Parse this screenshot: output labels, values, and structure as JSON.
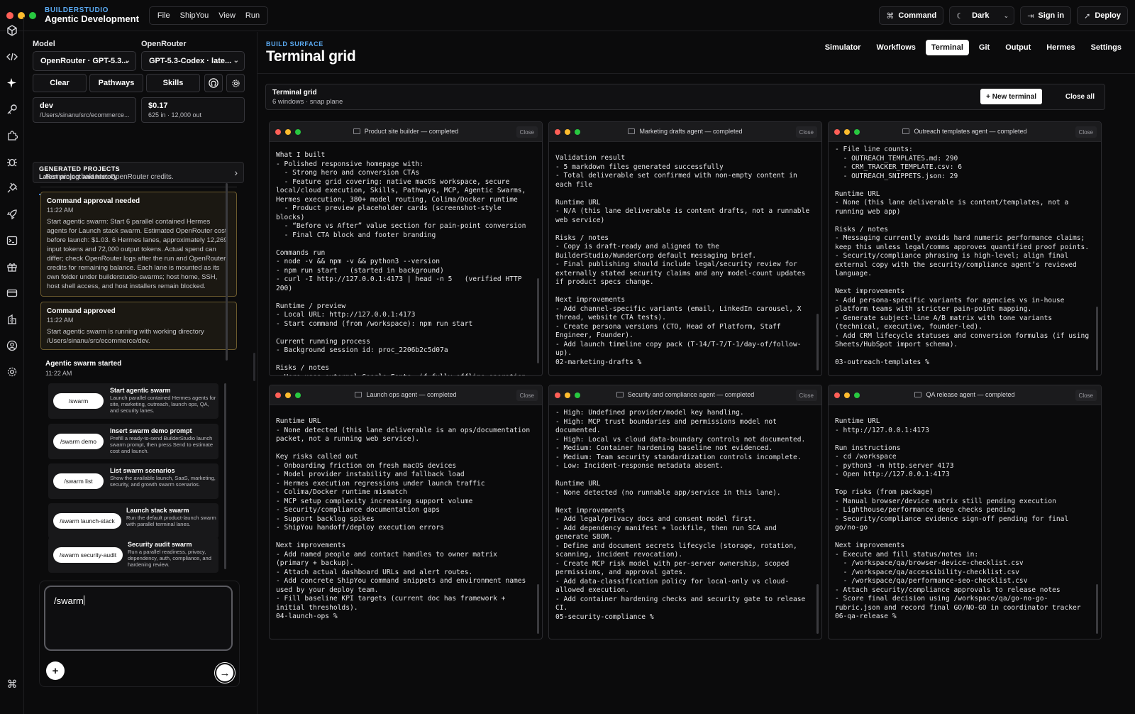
{
  "topbar": {
    "brand_eyebrow": "BUILDERSTUDIO",
    "brand_name": "Agentic Development",
    "menu": [
      "File",
      "ShipYou",
      "View",
      "Run"
    ],
    "command_label": "Command",
    "theme_label": "Dark",
    "signin_label": "Sign in",
    "deploy_label": "Deploy"
  },
  "left": {
    "model_label": "Model",
    "router_label": "OpenRouter",
    "model_value": "OpenRouter · GPT-5.3...",
    "router_value": "GPT-5.3-Codex · late...",
    "btn_clear": "Clear",
    "btn_pathways": "Pathways",
    "btn_skills": "Skills",
    "branch": "dev",
    "branch_path": "/Users/sinanu/src/ecommerce...",
    "cost": "$0.17",
    "tokens": "625 in · 12,000 out",
    "generated_title": "GENERATED PROJECTS",
    "generated_sub": "Latest project and history",
    "balance_text": "Remaining balance: OpenRouter credits.",
    "card1": {
      "title": "Command approval needed",
      "time": "11:22 AM",
      "body": "Start agentic swarm: Start 6 parallel contained Hermes agents for Launch stack swarm. Estimated OpenRouter cost before launch: $1.03. 6 Hermes lanes, approximately 12,269 input tokens and 72,000 output tokens. Actual spend can differ; check OpenRouter logs after the run and OpenRouter credits for remaining balance. Each lane is mounted as its own folder under builderstudio-swarms; host home, SSH, host shell access, and host installers remain blocked."
    },
    "card2": {
      "title": "Command approved",
      "time": "11:22 AM",
      "body": "Start agentic swarm is running with working directory /Users/sinanu/src/ecommerce/dev."
    },
    "swarm_started": "Agentic swarm started",
    "swarm_time": "11:22 AM",
    "commands": [
      {
        "pill": "/swarm",
        "title": "Start agentic swarm",
        "desc": "Launch parallel contained Hermes agents for site, marketing, outreach, launch ops, QA, and security lanes."
      },
      {
        "pill": "/swarm demo",
        "title": "Insert swarm demo prompt",
        "desc": "Prefill a ready-to-send BuilderStudio launch swarm prompt, then press Send to estimate cost and launch."
      },
      {
        "pill": "/swarm list",
        "title": "List swarm scenarios",
        "desc": "Show the available launch, SaaS, marketing, security, and growth swarm scenarios."
      },
      {
        "pill": "/swarm launch-stack",
        "title": "Launch stack swarm",
        "desc": "Run the default product-launch swarm with parallel terminal lanes."
      },
      {
        "pill": "/swarm security-audit",
        "title": "Security audit swarm",
        "desc": "Run a parallel readiness, privacy, dependency, auth, compliance, and hardening review."
      }
    ],
    "composer_value": "/swarm"
  },
  "main": {
    "eyebrow": "BUILD SURFACE",
    "title": "Terminal grid",
    "tabs": [
      "Simulator",
      "Workflows",
      "Terminal",
      "Git",
      "Output",
      "Hermes",
      "Settings"
    ],
    "active_tab": "Terminal",
    "grid_title": "Terminal grid",
    "grid_sub": "6 windows · snap plane",
    "new_terminal": "+ New terminal",
    "close_all": "Close all",
    "close_label": "Close",
    "terminals": [
      {
        "title": "Product site builder — completed",
        "body": "What I built\n- Polished responsive homepage with:\n  - Strong hero and conversion CTAs\n  - Feature grid covering: native macOS workspace, secure local/cloud execution, Skills, Pathways, MCP, Agentic Swarms, Hermes execution, 380+ model routing, Colima/Docker runtime\n  - Product preview placeholder cards (screenshot-style blocks)\n  - “Before vs After” value section for pain-point conversion\n  - Final CTA block and footer branding\n\nCommands run\n- node -v && npm -v && python3 --version\n- npm run start   (started in background)\n- curl -I http://127.0.0.1:4173 | head -n 5   (verified HTTP 200)\n\nRuntime / preview\n- Local URL: http://127.0.0.1:4173\n- Start command (from /workspace): npm run start\n\nCurrent running process\n- Background session id: proc_2206b2c5d07a\n\nRisks / notes\n- Hero uses external Google Fonts; if fully offline operation is required, switch to local/system fonts only."
      },
      {
        "title": "Marketing drafts agent — completed",
        "body": "Validation result\n- 5 markdown files generated successfully\n- Total deliverable set confirmed with non-empty content in each file\n\nRuntime URL\n- N/A (this lane deliverable is content drafts, not a runnable web service)\n\nRisks / notes\n- Copy is draft-ready and aligned to the BuilderStudio/WunderCorp default messaging brief.\n- Final publishing should include legal/security review for externally stated security claims and any model-count updates if product specs change.\n\nNext improvements\n- Add channel-specific variants (email, LinkedIn carousel, X thread, website CTA tests).\n- Create persona versions (CTO, Head of Platform, Staff Engineer, Founder).\n- Add launch timeline copy pack (T-14/T-7/T-1/day-of/follow-up).\n02-marketing-drafts %"
      },
      {
        "title": "Outreach templates agent — completed",
        "body": "- File line counts:\n  - OUTREACH_TEMPLATES.md: 290\n  - CRM_TRACKER_TEMPLATE.csv: 6\n  - OUTREACH_SNIPPETS.json: 29\n\nRuntime URL\n- None (this lane deliverable is content/templates, not a running web app)\n\nRisks / notes\n- Messaging currently avoids hard numeric performance claims; keep this unless legal/comms approves quantified proof points.\n- Security/compliance phrasing is high-level; align final external copy with the security/compliance agent’s reviewed language.\n\nNext improvements\n- Add persona-specific variants for agencies vs in-house platform teams with stricter pain-point mapping.\n- Generate subject-line A/B matrix with tone variants (technical, executive, founder-led).\n- Add CRM lifecycle statuses and conversion formulas (if using Sheets/HubSpot import schema).\n\n03-outreach-templates %"
      },
      {
        "title": "Launch ops agent — completed",
        "body": "Runtime URL\n- None detected (this lane deliverable is an ops/documentation packet, not a running web service).\n\nKey risks called out\n- Onboarding friction on fresh macOS devices\n- Model provider instability and fallback load\n- Hermes execution regressions under launch traffic\n- Colima/Docker runtime mismatch\n- MCP setup complexity increasing support volume\n- Security/compliance documentation gaps\n- Support backlog spikes\n- ShipYou handoff/deploy execution errors\n\nNext improvements\n- Add named people and contact handles to owner matrix (primary + backup).\n- Attach actual dashboard URLs and alert routes.\n- Add concrete ShipYou command snippets and environment names used by your deploy team.\n- Fill baseline KPI targets (current doc has framework + initial thresholds).\n04-launch-ops %"
      },
      {
        "title": "Security and compliance agent — completed",
        "body": "- High: Undefined provider/model key handling.\n- High: MCP trust boundaries and permissions model not documented.\n- High: Local vs cloud data-boundary controls not documented.\n- Medium: Container hardening baseline not evidenced.\n- Medium: Team security standardization controls incomplete.\n- Low: Incident-response metadata absent.\n\nRuntime URL\n- None detected (no runnable app/service in this lane).\n\nNext improvements\n- Add legal/privacy docs and consent model first.\n- Add dependency manifest + lockfile, then run SCA and generate SBOM.\n- Define and document secrets lifecycle (storage, rotation, scanning, incident revocation).\n- Create MCP risk model with per-server ownership, scoped permissions, and approval gates.\n- Add data-classification policy for local-only vs cloud-allowed execution.\n- Add container hardening checks and security gate to release CI.\n05-security-compliance %"
      },
      {
        "title": "QA release agent — completed",
        "body": "Runtime URL\n- http://127.0.0.1:4173\n\nRun instructions\n- cd /workspace\n- python3 -m http.server 4173\n- Open http://127.0.0.1:4173\n\nTop risks (from package)\n- Manual browser/device matrix still pending execution\n- Lighthouse/performance deep checks pending\n- Security/compliance evidence sign-off pending for final go/no-go\n\nNext improvements\n- Execute and fill status/notes in:\n  - /workspace/qa/browser-device-checklist.csv\n  - /workspace/qa/accessibility-checklist.csv\n  - /workspace/qa/performance-seo-checklist.csv\n- Attach security/compliance approvals to release notes\n- Score final decision using /workspace/qa/go-no-go-rubric.json and record final GO/NO-GO in coordinator tracker\n06-qa-release %"
      }
    ]
  },
  "colors": {
    "accent_blue": "#5aa9f0",
    "close_red": "#ff5f57",
    "min_yellow": "#febc2e",
    "max_green": "#28c840",
    "approval_border": "#6b5a2e"
  },
  "icons": [
    "cube-icon",
    "code-icon",
    "sparkle-icon",
    "key-icon",
    "puzzle-icon",
    "bug-icon",
    "plug-icon",
    "rocket-icon",
    "terminal-icon",
    "gift-icon",
    "card-icon",
    "building-icon",
    "user-icon",
    "gear-icon",
    "command-icon"
  ]
}
